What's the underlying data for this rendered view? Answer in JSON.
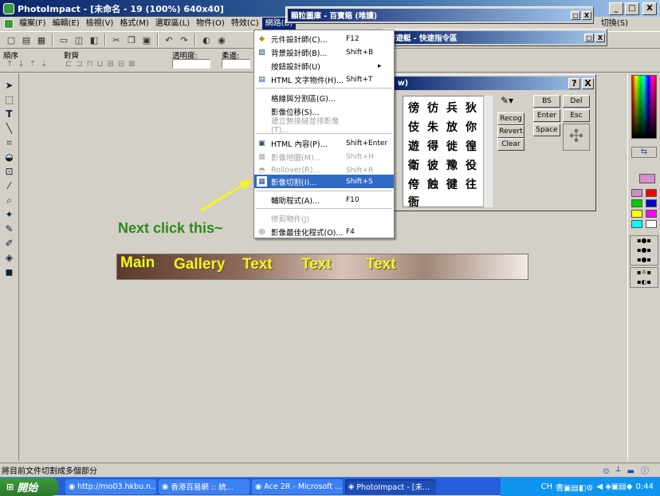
{
  "app": {
    "title": "PhotoImpact - [未命名 - 19 (100%) 640x40]",
    "title_buttons": [
      "_",
      "□",
      "X"
    ]
  },
  "menubar": {
    "items": [
      "檔案(F)",
      "編輯(E)",
      "檢視(V)",
      "格式(M)",
      "選取區(L)",
      "物件(O)",
      "特效(C)",
      "網路(B)"
    ],
    "active": "網路(B)"
  },
  "attrbar": {
    "order_label": "順序",
    "align_label": "對齊",
    "opacity_label": "透明度:",
    "soften_label": "柔邊:"
  },
  "web_menu": {
    "items": [
      {
        "label": "元件設計師(C)...",
        "shortcut": "F12",
        "icon": "component-icon",
        "disabled": false
      },
      {
        "label": "背景設計師(B)...",
        "shortcut": "Shift+B",
        "icon": "background-icon",
        "disabled": false
      },
      {
        "label": "按鈕設計師(U)",
        "shortcut": "",
        "icon": "",
        "disabled": false,
        "submenu": true
      },
      {
        "label": "HTML 文字物件(H)...",
        "shortcut": "Shift+T",
        "icon": "html-text-icon",
        "disabled": false
      },
      {
        "label": "格線與分割區(G)...",
        "shortcut": "",
        "icon": "",
        "disabled": false
      },
      {
        "label": "影像位移(S)...",
        "shortcut": "",
        "icon": "",
        "disabled": false
      },
      {
        "label": "建立無接縫並排影像(T)...",
        "shortcut": "",
        "icon": "",
        "disabled": true
      },
      {
        "label": "HTML 內容(P)...",
        "shortcut": "Shift+Enter",
        "icon": "html-props-icon",
        "disabled": false
      },
      {
        "label": "影像地圖(M)...",
        "shortcut": "Shift+H",
        "icon": "image-map-icon",
        "disabled": true
      },
      {
        "label": "Rollover(R)...",
        "shortcut": "Shift+R",
        "icon": "rollover-icon",
        "disabled": true
      },
      {
        "label": "影像切割(I)...",
        "shortcut": "Shift+S",
        "icon": "slicer-icon",
        "disabled": false,
        "highlighted": true
      },
      {
        "label": "輔助程式(A)...",
        "shortcut": "F10",
        "icon": "",
        "disabled": false
      },
      {
        "label": "修剪物件(J)",
        "shortcut": "",
        "icon": "",
        "disabled": true
      },
      {
        "label": "影像最佳化程式(O)...",
        "shortcut": "F4",
        "icon": "optimizer-icon",
        "disabled": false
      }
    ]
  },
  "gallery_window": {
    "title": "顆粒圖庫 - 百寶箱 (唯讀)",
    "buttons": [
      "□",
      "X"
    ]
  },
  "quick_window": {
    "title": "層遊艇 - 快速指令區",
    "buttons": [
      "□",
      "X"
    ]
  },
  "handwriting_window": {
    "title_fragment": "w)",
    "chars": [
      "徬",
      "彷",
      "兵",
      "狄",
      "伎",
      "朱",
      "放",
      "你",
      "遊",
      "得",
      "徙",
      "徨",
      "衛",
      "彼",
      "豫",
      "役",
      "侉",
      "蝕",
      "徤",
      "往",
      "衙"
    ],
    "recog_label": "Recog",
    "revert_label": "Revert",
    "clear_label": "Clear",
    "bs_label": "BS",
    "del_label": "Del",
    "enter_label": "Enter",
    "esc_label": "Esc",
    "space_label": "Space"
  },
  "outer_right": {
    "switch_label": "切換(S)"
  },
  "canvas": {
    "annotation": "Next click this~",
    "banner_texts": [
      "Main",
      "Gallery",
      "Text",
      "Text",
      "Text"
    ]
  },
  "status": {
    "text": "將目前文件切割成多個部分"
  },
  "taskbar": {
    "start_label": "開始",
    "tasks": [
      {
        "label": "http://mo03.hkbu.n..."
      },
      {
        "label": "香港百易網 :: 統..."
      },
      {
        "label": "Ace 2R - Microsoft ..."
      },
      {
        "label": "PhotoImpact - [未..."
      }
    ],
    "ime_label": "CH",
    "clock": "0:44"
  },
  "colors": {
    "highlight": "#316AC5",
    "annotation_green": "#2A8A1E",
    "arrow_yellow": "#F5F520",
    "banner_text": "#F5F520"
  }
}
